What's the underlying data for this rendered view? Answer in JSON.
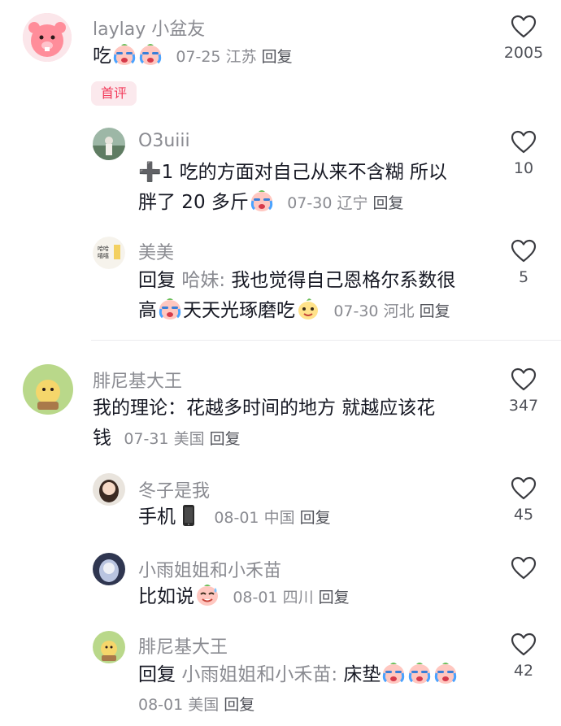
{
  "comments": [
    {
      "username": "laylay 小盆友",
      "text": "吃",
      "meta_date": "07-25",
      "meta_location": "江苏",
      "reply_label": "回复",
      "badge": "首评",
      "likes": "2005"
    },
    {
      "username": "O3uiii",
      "text_line1": "➕1 吃的方面对自己从来不含糊 所以",
      "text_line2": "胖了 20 多斤",
      "meta_date": "07-30",
      "meta_location": "辽宁",
      "reply_label": "回复",
      "likes": "10"
    },
    {
      "username": "美美",
      "reply_prefix": "回复",
      "reply_to": "哈妹:",
      "text_line1": "我也觉得自己恩格尔系数很",
      "text_line2a": "高",
      "text_line2b": "天天光琢磨吃",
      "meta_date": "07-30",
      "meta_location": "河北",
      "reply_label": "回复",
      "likes": "5"
    },
    {
      "username": "腓尼基大王",
      "text_line1": "我的理论：花越多时间的地方 就越应该花",
      "text_line2": "钱",
      "meta_date": "07-31",
      "meta_location": "美国",
      "reply_label": "回复",
      "likes": "347"
    },
    {
      "username": "冬子是我",
      "text": "手机",
      "meta_date": "08-01",
      "meta_location": "中国",
      "reply_label": "回复",
      "likes": "45"
    },
    {
      "username": "小雨姐姐和小禾苗",
      "text": "比如说",
      "meta_date": "08-01",
      "meta_location": "四川",
      "reply_label": "回复",
      "likes": ""
    },
    {
      "username": "腓尼基大王",
      "reply_prefix": "回复",
      "reply_to": "小雨姐姐和小禾苗:",
      "text": "床垫",
      "meta_date": "08-01",
      "meta_location": "美国",
      "reply_label": "回复",
      "likes": "42"
    }
  ],
  "icons": {
    "like": "heart-outline-icon",
    "emoji_cry": "crying-face-emoji",
    "emoji_smile": "pear-face-emoji",
    "emoji_sweat": "sweat-face-emoji",
    "emoji_phone": "mobile-phone-emoji",
    "emoji_plus": "heavy-plus-emoji"
  },
  "colors": {
    "text": "#161823",
    "meta": "#8a8b91",
    "reply": "#505259",
    "badge_bg": "#fbe9ed",
    "badge_text": "#f23a5a"
  }
}
